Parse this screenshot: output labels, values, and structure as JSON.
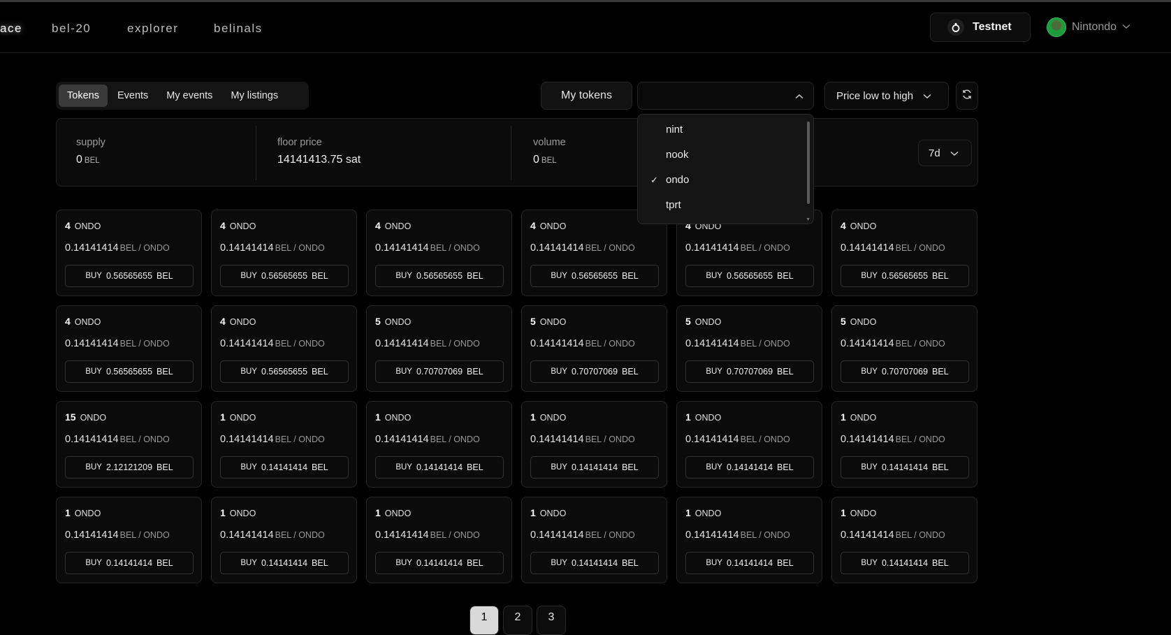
{
  "nav": {
    "items": [
      {
        "label": "ace",
        "name": "nav-item-marketplace"
      },
      {
        "label": "bel-20",
        "name": "nav-item-bel-20"
      },
      {
        "label": "explorer",
        "name": "nav-item-explorer"
      },
      {
        "label": "belinals",
        "name": "nav-item-belinals"
      }
    ],
    "network_label": "Testnet",
    "network_icon": "network-icon",
    "user_name": "Nintondo"
  },
  "tabs": [
    "Tokens",
    "Events",
    "My events",
    "My listings"
  ],
  "controls": {
    "my_tokens_label": "My tokens",
    "token_select_value": "",
    "sort_label": "Price low to high",
    "refresh_icon": "refresh-icon"
  },
  "stats": {
    "supply_label": "supply",
    "supply_value": "0",
    "supply_unit": "BEL",
    "floor_label": "floor price",
    "floor_value": "14141413.75 sat",
    "volume_label": "volume",
    "volume_value": "0",
    "volume_unit": "BEL",
    "period": "7d"
  },
  "dropdown": {
    "options": [
      "nint",
      "nook",
      "ondo",
      "tprt"
    ],
    "selected": "ondo",
    "check_glyph": "✓"
  },
  "card_labels": {
    "ticker": "ONDO",
    "price": "0.14141414",
    "price_unit": "BEL / ONDO",
    "buy_label": "BUY",
    "buy_unit": "BEL"
  },
  "cards": [
    {
      "amount": "4",
      "total": "0.56565655"
    },
    {
      "amount": "4",
      "total": "0.56565655"
    },
    {
      "amount": "4",
      "total": "0.56565655"
    },
    {
      "amount": "4",
      "total": "0.56565655"
    },
    {
      "amount": "4",
      "total": "0.56565655"
    },
    {
      "amount": "4",
      "total": "0.56565655"
    },
    {
      "amount": "4",
      "total": "0.56565655"
    },
    {
      "amount": "4",
      "total": "0.56565655"
    },
    {
      "amount": "5",
      "total": "0.70707069"
    },
    {
      "amount": "5",
      "total": "0.70707069"
    },
    {
      "amount": "5",
      "total": "0.70707069"
    },
    {
      "amount": "5",
      "total": "0.70707069"
    },
    {
      "amount": "15",
      "total": "2.12121209"
    },
    {
      "amount": "1",
      "total": "0.14141414"
    },
    {
      "amount": "1",
      "total": "0.14141414"
    },
    {
      "amount": "1",
      "total": "0.14141414"
    },
    {
      "amount": "1",
      "total": "0.14141414"
    },
    {
      "amount": "1",
      "total": "0.14141414"
    },
    {
      "amount": "1",
      "total": "0.14141414"
    },
    {
      "amount": "1",
      "total": "0.14141414"
    },
    {
      "amount": "1",
      "total": "0.14141414"
    },
    {
      "amount": "1",
      "total": "0.14141414"
    },
    {
      "amount": "1",
      "total": "0.14141414"
    },
    {
      "amount": "1",
      "total": "0.14141414"
    }
  ],
  "pagination": {
    "pages": [
      "1",
      "2",
      "3"
    ],
    "current": "1"
  }
}
